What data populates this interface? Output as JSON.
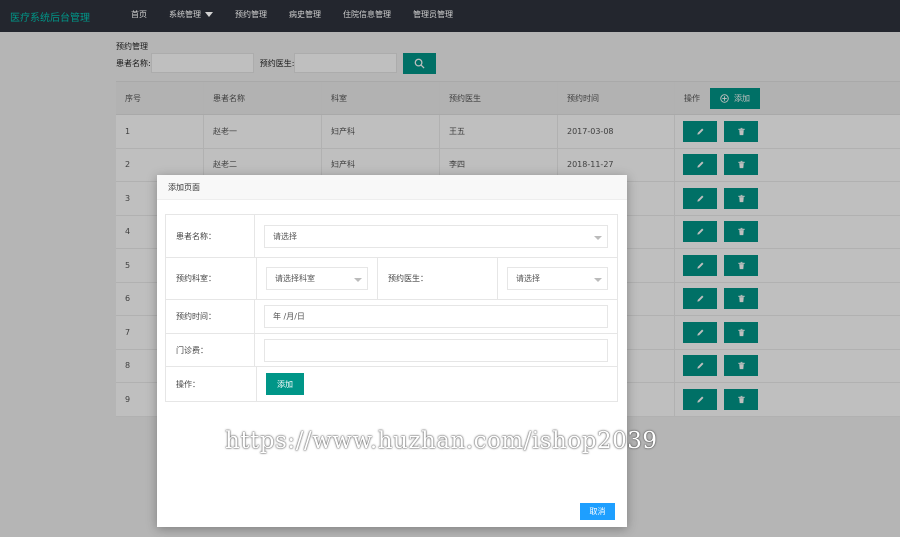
{
  "app": {
    "brand": "医疗系统后台管理",
    "nav": [
      "首页",
      "系统管理",
      "预约管理",
      "病史管理",
      "住院信息管理",
      "管理员管理"
    ]
  },
  "search": {
    "section_title": "预约管理",
    "patient_label": "患者名称:",
    "doctor_label": "预约医生:"
  },
  "table": {
    "headers": [
      "序号",
      "患者名称",
      "科室",
      "预约医生",
      "预约时间",
      "操作"
    ],
    "add_label": "添加",
    "rows": [
      [
        "1",
        "赵老一",
        "妇产科",
        "王五",
        "2017-03-08"
      ],
      [
        "2",
        "赵老二",
        "妇产科",
        "李四",
        "2018-11-27"
      ],
      [
        "3",
        "",
        "",
        "",
        ""
      ],
      [
        "4",
        "",
        "",
        "",
        ""
      ],
      [
        "5",
        "",
        "",
        "",
        ""
      ],
      [
        "6",
        "",
        "",
        "",
        ""
      ],
      [
        "7",
        "",
        "",
        "",
        ""
      ],
      [
        "8",
        "",
        "",
        "",
        ""
      ],
      [
        "9",
        "",
        "",
        "",
        ""
      ]
    ]
  },
  "modal": {
    "title": "添加页面",
    "patient_label": "患者名称：",
    "patient_placeholder": "请选择",
    "dept_label": "预约科室：",
    "dept_placeholder": "请选择科室",
    "doctor_label": "预约医生：",
    "doctor_placeholder": "请选择",
    "time_label": "预约时间：",
    "time_value": "年 /月/日",
    "fee_label": "门诊费：",
    "fee_value": "",
    "ops_label": "操作：",
    "submit_label": "添加",
    "cancel_label": "取消"
  },
  "watermark": "https://www.huzhan.com/ishop2039",
  "colors": {
    "accent": "#009688",
    "topbar": "#23262e",
    "cancel": "#1e9fff"
  }
}
